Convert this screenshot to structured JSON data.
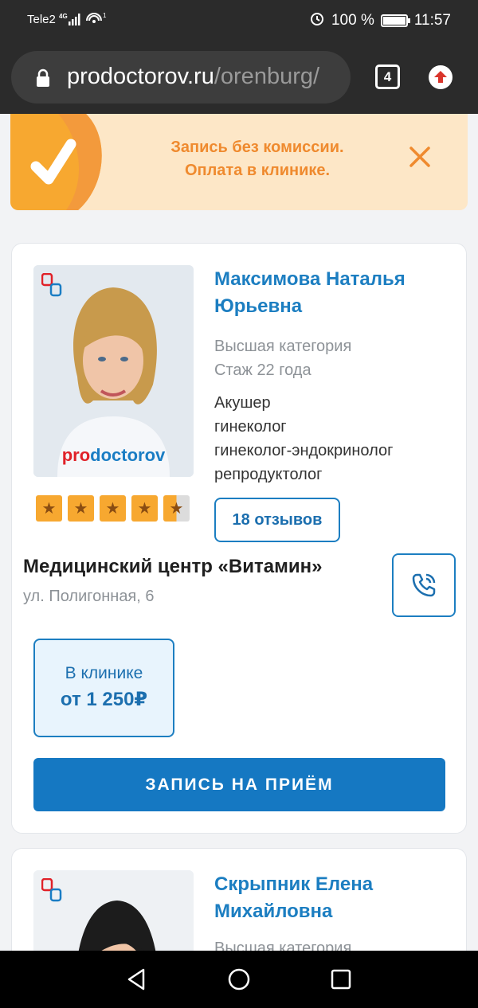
{
  "status": {
    "carrier": "Tele2",
    "network": "4G",
    "battery": "100 %",
    "time": "11:57"
  },
  "browser": {
    "url_host": "prodoctorov.ru",
    "url_path": "/orenburg/",
    "tab_count": "4"
  },
  "promo": {
    "line1": "Запись без комиссии.",
    "line2": "Оплата в клинике."
  },
  "doctor": {
    "name": "Максимова Наталья Юрьевна",
    "category": "Высшая категория",
    "experience": "Стаж 22 года",
    "specialties": [
      "Акушер",
      "гинеколог",
      "гинеколог-эндокринолог",
      "репродуктолог"
    ],
    "rating_stars": 4.5,
    "reviews_label": "18 отзывов",
    "photo_watermark_pro": "pro",
    "photo_watermark_doc": "doctorov",
    "clinic": "Медицинский центр «Витамин»",
    "address": "ул. Полигонная, 6",
    "price_where": "В клинике",
    "price_value": "от 1 250₽",
    "book_label": "ЗАПИСЬ НА ПРИЁМ"
  },
  "doctor2": {
    "name": "Скрыпник Елена Михайловна",
    "category": "Высшая категория"
  },
  "colors": {
    "brand_blue": "#1c7ec1",
    "button_blue": "#1578c2",
    "promo_orange": "#ef8a2e",
    "promo_bg": "#fde7c7",
    "star": "#f7a830"
  }
}
